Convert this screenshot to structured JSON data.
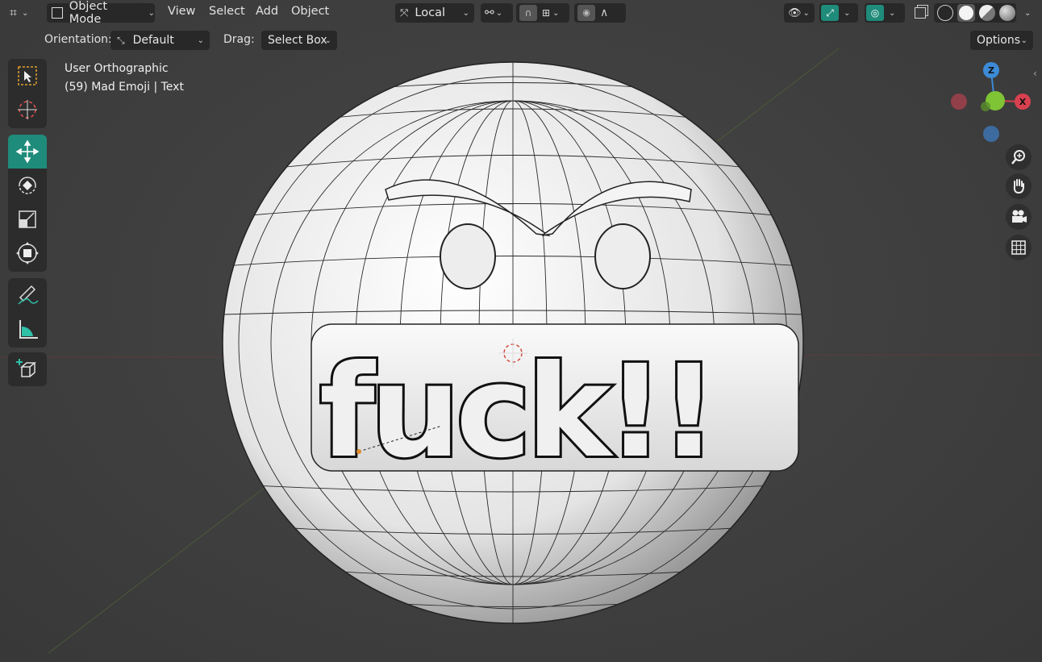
{
  "header": {
    "mode_label": "Object Mode",
    "menus": [
      "View",
      "Select",
      "Add",
      "Object"
    ],
    "transform_space": "Local",
    "options_label": "Options"
  },
  "tool_settings": {
    "orientation_label": "Orientation:",
    "orientation_value": "Default",
    "drag_label": "Drag:",
    "drag_value": "Select Box"
  },
  "viewport": {
    "view_name": "User Orthographic",
    "object_info": "(59) Mad Emoji | Text"
  },
  "model": {
    "text": "fuck!!"
  },
  "gizmo": {
    "z": "Z",
    "x": "X"
  },
  "colors": {
    "accent": "#1f8b7a",
    "axis_x": "#d9404f",
    "axis_y": "#7fc435",
    "axis_z": "#3d8ad7"
  },
  "icons": {
    "toolbar": [
      "select-box-icon",
      "cursor-icon",
      "move-icon",
      "rotate-icon",
      "scale-icon",
      "transform-icon",
      "annotate-icon",
      "measure-icon",
      "add-cube-icon"
    ],
    "nav": [
      "zoom-icon",
      "hand-icon",
      "camera-icon",
      "grid-icon"
    ]
  },
  "active_tool": "move"
}
